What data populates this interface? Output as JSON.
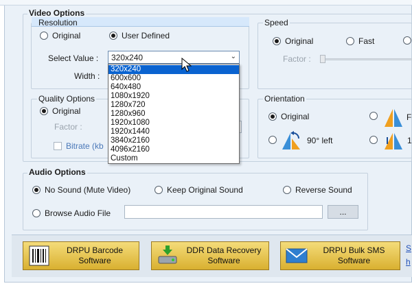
{
  "video_options": {
    "title": "Video Options",
    "resolution": {
      "title": "Resolution",
      "original_label": "Original",
      "user_defined_label": "User Defined",
      "select_value_label": "Select Value :",
      "selected_value": "320x240",
      "width_label": "Width :",
      "options": [
        "320x240",
        "600x600",
        "640x480",
        "1080x1920",
        "1280x720",
        "1280x960",
        "1920x1080",
        "1920x1440",
        "3840x2160",
        "4096x2160",
        "Custom"
      ]
    },
    "speed": {
      "title": "Speed",
      "original_label": "Original",
      "fast_label": "Fast",
      "factor_label": "Factor :"
    },
    "quality": {
      "title": "Quality Options",
      "original_label": "Original",
      "factor_label": "Factor :",
      "bitrate_label": "Bitrate (kb"
    },
    "orientation": {
      "title": "Orientation",
      "original_label": "Original",
      "rotate_left_label": "90° left",
      "flip_label_partial": "F",
      "right_label_partial": "1"
    }
  },
  "audio_options": {
    "title": "Audio Options",
    "no_sound_label": "No Sound (Mute Video)",
    "keep_sound_label": "Keep Original Sound",
    "reverse_sound_label": "Reverse Sound",
    "browse_label": "Browse Audio File",
    "browse_button_label": "..."
  },
  "promos": [
    {
      "line1": "DRPU Barcode",
      "line2": "Software"
    },
    {
      "line1": "DDR Data Recovery",
      "line2": "Software"
    },
    {
      "line1": "DRPU Bulk SMS",
      "line2": "Software"
    }
  ],
  "side_links": [
    "S",
    "h"
  ],
  "colors": {
    "panel": "#eaf1f8",
    "selection": "#0a63d0",
    "promo_gold": "#d9b030"
  }
}
